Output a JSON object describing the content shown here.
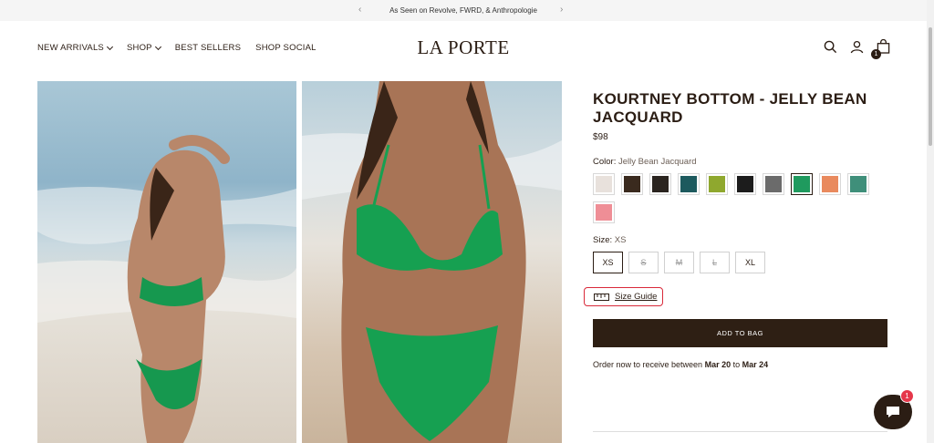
{
  "announcement": {
    "text": "As Seen on Revolve, FWRD, & Anthropologie"
  },
  "header": {
    "nav": [
      {
        "label": "NEW ARRIVALS",
        "dropdown": true
      },
      {
        "label": "SHOP",
        "dropdown": true
      },
      {
        "label": "BEST SELLERS",
        "dropdown": false
      },
      {
        "label": "SHOP SOCIAL",
        "dropdown": false
      }
    ],
    "logo": "LA PORTE",
    "cart_count": "1"
  },
  "product": {
    "title": "KOURTNEY BOTTOM - JELLY BEAN JACQUARD",
    "price": "$98",
    "color_label": "Color:",
    "color_value": "Jelly Bean Jacquard",
    "swatches": [
      {
        "color": "#e8e1dc"
      },
      {
        "color": "#3a2a1e"
      },
      {
        "color": "#2a241f"
      },
      {
        "color": "#1d5a5e"
      },
      {
        "color": "#8fa82e"
      },
      {
        "color": "#1c1c1c"
      },
      {
        "color": "#6b6b6b"
      },
      {
        "color": "#1f9a5e"
      },
      {
        "color": "#e98a5e"
      },
      {
        "color": "#3f8f7a"
      },
      {
        "color": "#ef8e96"
      }
    ],
    "active_swatch": 7,
    "size_label": "Size:",
    "size_value": "XS",
    "sizes": [
      {
        "label": "XS",
        "state": "active"
      },
      {
        "label": "S",
        "state": "oos"
      },
      {
        "label": "M",
        "state": "oos"
      },
      {
        "label": "L",
        "state": "oos"
      },
      {
        "label": "XL",
        "state": "available"
      }
    ],
    "size_guide": "Size Guide",
    "add_to_bag": "ADD TO BAG",
    "order_prefix": "Order now to receive between",
    "order_start": "Mar 20",
    "order_to": "to",
    "order_end": "Mar 24"
  },
  "chat": {
    "badge": "1"
  },
  "colors": {
    "brand": "#2e1f14",
    "highlight": "#d9293a",
    "chat_badge": "#e5374a"
  }
}
